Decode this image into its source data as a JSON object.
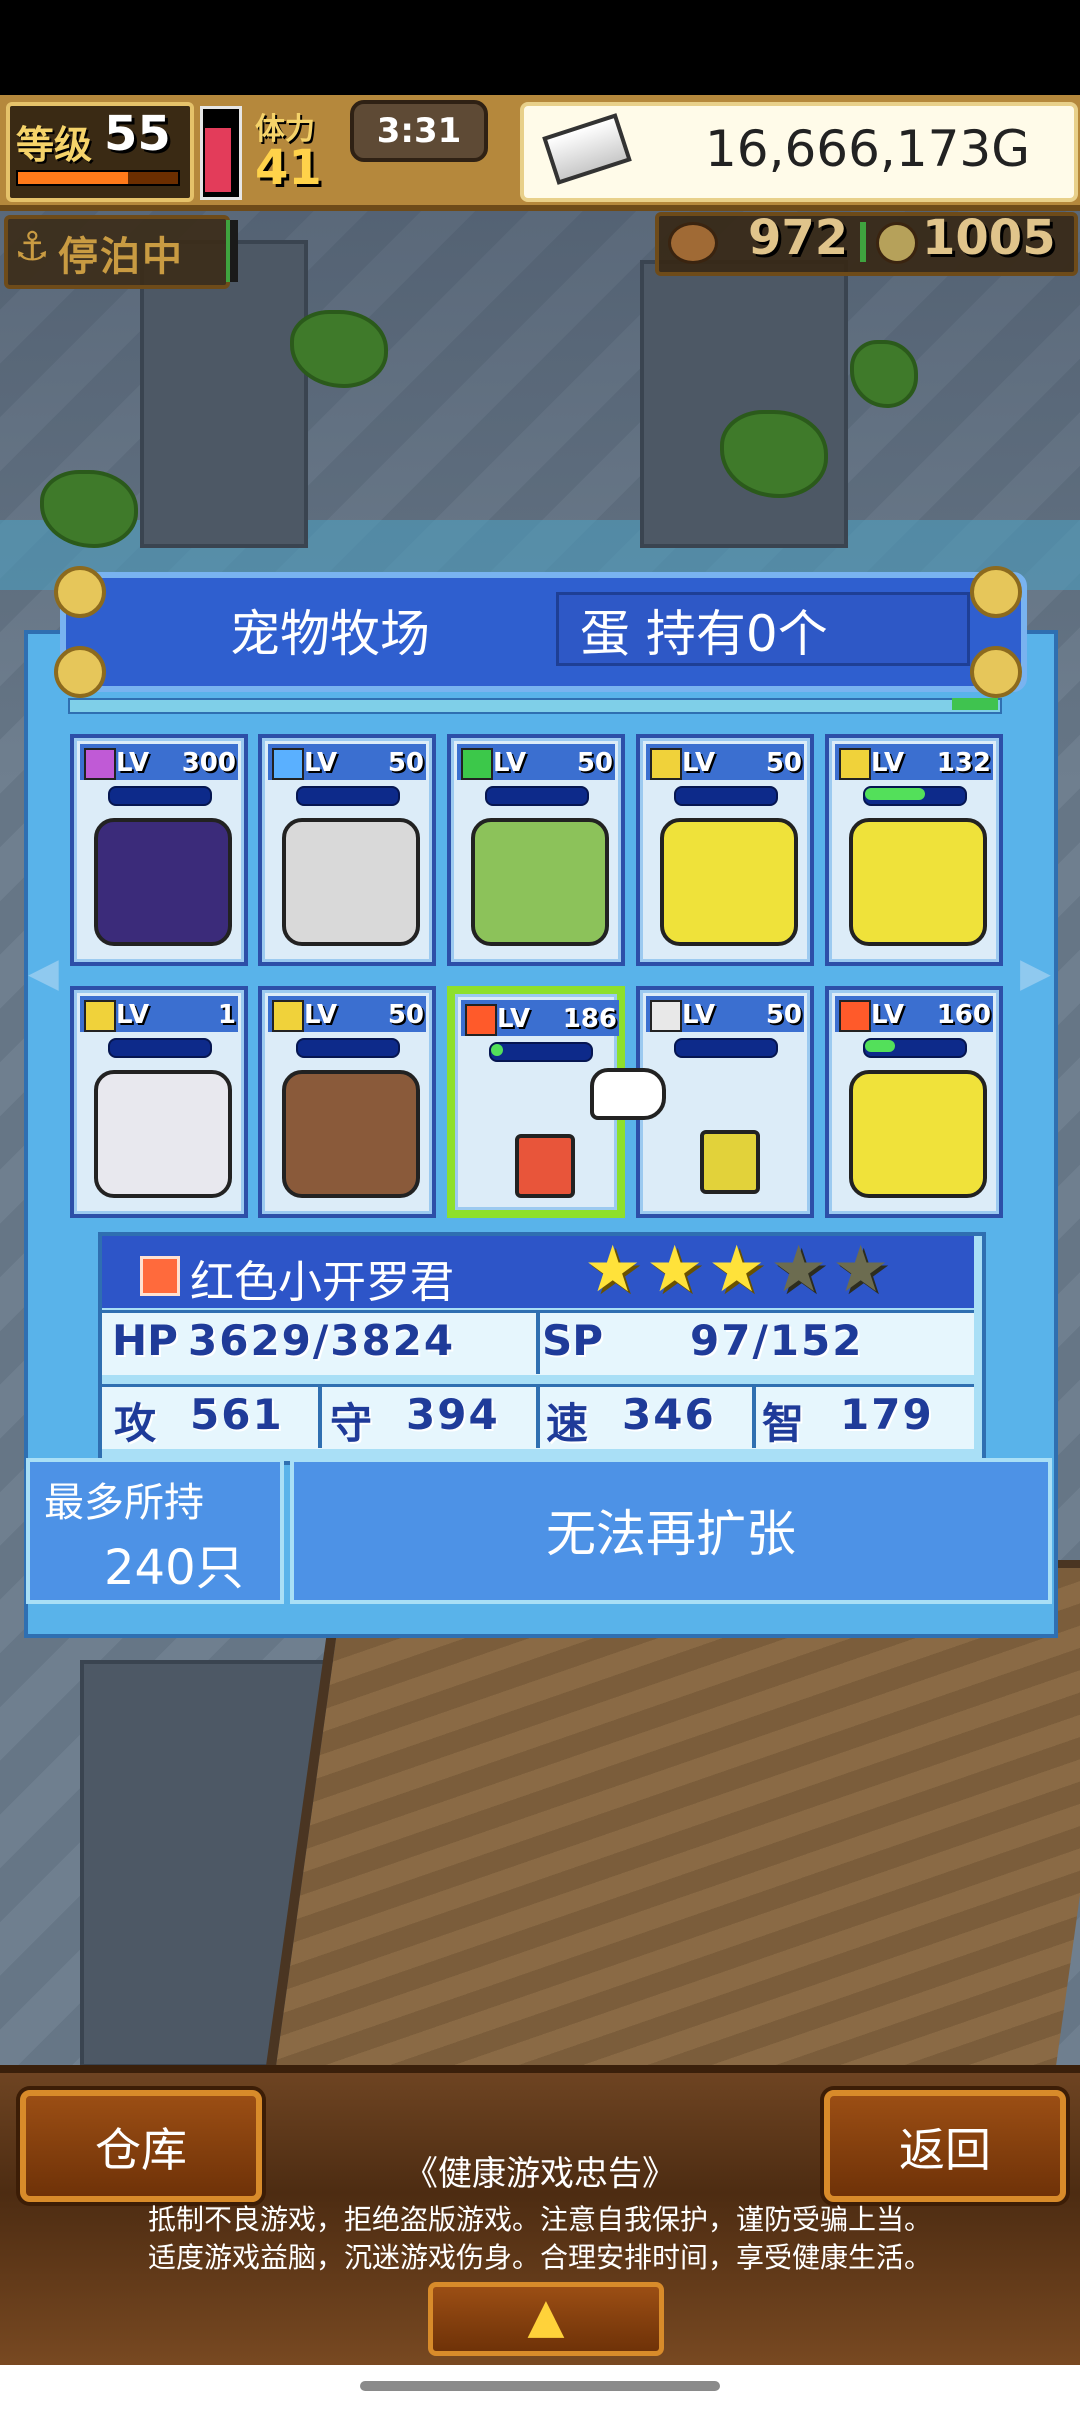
{
  "hud": {
    "level_label": "等级",
    "level_value": "55",
    "stamina_label": "体力",
    "stamina_value": "41",
    "timer": "3:31",
    "gold": "16,666,173G",
    "dock_status": "停泊中",
    "resource1": "972",
    "resource2": "1005"
  },
  "panel": {
    "title": "宠物牧场",
    "egg_status": "蛋 持有0个"
  },
  "pets": [
    {
      "lv_label": "LV",
      "lv": "300",
      "element": "#c05ad6",
      "hp_fraction": 0,
      "sprite": "#3b2b7a"
    },
    {
      "lv_label": "LV",
      "lv": "50",
      "element": "#5ab0ff",
      "hp_fraction": 0,
      "sprite": "#d9d9d9"
    },
    {
      "lv_label": "LV",
      "lv": "50",
      "element": "#3cc84a",
      "hp_fraction": 0,
      "sprite": "#8cc25a"
    },
    {
      "lv_label": "LV",
      "lv": "50",
      "element": "#f0d23a",
      "hp_fraction": 0,
      "sprite": "#efe23a"
    },
    {
      "lv_label": "LV",
      "lv": "132",
      "element": "#f0d23a",
      "hp_fraction": 0.6,
      "sprite": "#efe23a"
    },
    {
      "lv_label": "LV",
      "lv": "1",
      "element": "#f0d23a",
      "hp_fraction": 0,
      "sprite": "#e8e8ee"
    },
    {
      "lv_label": "LV",
      "lv": "50",
      "element": "#f0d23a",
      "hp_fraction": 0,
      "sprite": "#8a5a3a"
    },
    {
      "lv_label": "LV",
      "lv": "186",
      "element": "#ff5a2a",
      "hp_fraction": 0.12,
      "sprite": "#e8553a",
      "selected": true
    },
    {
      "lv_label": "LV",
      "lv": "50",
      "element": "#e8e8e8",
      "hp_fraction": 0,
      "sprite": "#e2d23a"
    },
    {
      "lv_label": "LV",
      "lv": "160",
      "element": "#ff5a2a",
      "hp_fraction": 0.3,
      "sprite": "#f0e23a"
    }
  ],
  "selected_pet": {
    "name": "红色小开罗君",
    "stars": 3,
    "stars_total": 5,
    "hp_label": "HP",
    "hp": "3629/3824",
    "sp_label": "SP",
    "sp": "97/152",
    "atk_label": "攻",
    "atk": "561",
    "def_label": "守",
    "def": "394",
    "spd_label": "速",
    "spd": "346",
    "int_label": "智",
    "int": "179"
  },
  "capacity": {
    "label": "最多所持",
    "value": "240只"
  },
  "expand_button": "无法再扩张",
  "bottom": {
    "warehouse_button": "仓库",
    "back_button": "返回",
    "notice_title": "《健康游戏忠告》",
    "notice_line1": "抵制不良游戏，拒绝盗版游戏。注意自我保护，谨防受骗上当。",
    "notice_line2": "适度游戏益脑，沉迷游戏伤身。合理安排时间，享受健康生活。"
  },
  "colors": {
    "panel_blue": "#59b3ea",
    "header_blue": "#2f5fcf",
    "selected_border": "#8ee02c",
    "hp_green": "#53e05a"
  },
  "icons": {
    "dock": "anchor-icon",
    "resource1": "meat-icon",
    "resource2": "coin-icon",
    "gold": "ingot-icon",
    "up": "up-arrow-icon"
  }
}
